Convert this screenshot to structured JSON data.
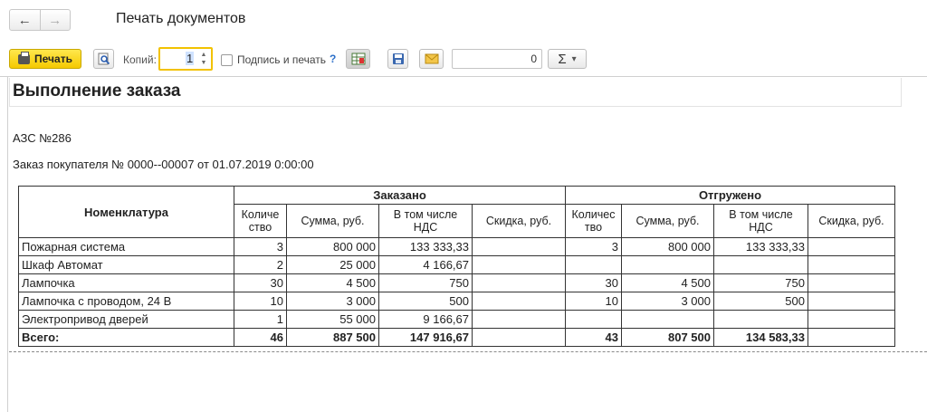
{
  "window": {
    "title": "Печать документов"
  },
  "toolbar": {
    "print_label": "Печать",
    "copies_label": "Копий:",
    "copies_value": "1",
    "sign_print_label": "Подпись и печать",
    "help": "?",
    "number_value": "0",
    "sum_symbol": "Σ",
    "sum_arrow": "▾"
  },
  "document": {
    "title": "Выполнение заказа",
    "station": "АЗС №286",
    "order": "Заказ покупателя № 0000--00007 от 01.07.2019 0:00:00",
    "table": {
      "col_nomenclature": "Номенклатура",
      "group_ordered": "Заказано",
      "group_shipped": "Отгружено",
      "sub_headers": [
        "Количе ство",
        "Сумма, руб.",
        "В том числе НДС",
        "Скидка, руб.",
        "Количес тво",
        "Сумма, руб.",
        "В том числе НДС",
        "Скидка, руб."
      ],
      "rows": [
        [
          "Пожарная система",
          "3",
          "800 000",
          "133 333,33",
          "",
          "3",
          "800 000",
          "133 333,33",
          ""
        ],
        [
          "Шкаф Автомат",
          "2",
          "25 000",
          "4 166,67",
          "",
          "",
          "",
          "",
          ""
        ],
        [
          "Лампочка",
          "30",
          "4 500",
          "750",
          "",
          "30",
          "4 500",
          "750",
          ""
        ],
        [
          "Лампочка с проводом, 24 В",
          "10",
          "3 000",
          "500",
          "",
          "10",
          "3 000",
          "500",
          ""
        ],
        [
          "Электропривод дверей",
          "1",
          "55 000",
          "9 166,67",
          "",
          "",
          "",
          "",
          ""
        ]
      ],
      "total": [
        "Всего:",
        "46",
        "887 500",
        "147 916,67",
        "",
        "43",
        "807 500",
        "134 583,33",
        ""
      ]
    }
  },
  "icons": {
    "back": "arrow-left-icon",
    "forward": "arrow-right-icon",
    "print": "printer-icon",
    "preview": "magnifier-icon",
    "settings": "table-settings-icon",
    "save": "floppy-disk-icon",
    "email": "envelope-icon"
  }
}
